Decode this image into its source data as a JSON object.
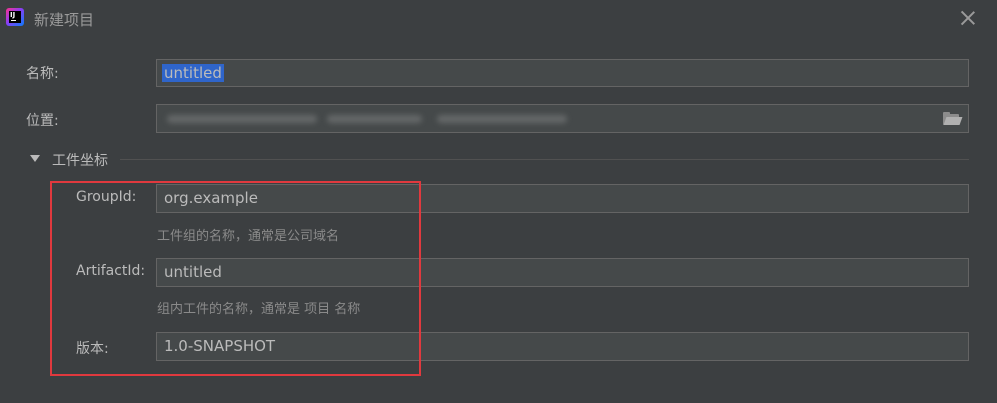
{
  "window": {
    "title": "新建项目",
    "app_icon_text": "IJ"
  },
  "form": {
    "name": {
      "label": "名称:",
      "value": "untitled"
    },
    "location": {
      "label": "位置:",
      "value": ""
    }
  },
  "artifact_section": {
    "title": "工件坐标",
    "expanded": true,
    "group_id": {
      "label": "GroupId:",
      "value": "org.example",
      "hint": "工件组的名称，通常是公司域名"
    },
    "artifact_id": {
      "label": "ArtifactId:",
      "value": "untitled",
      "hint": "组内工件的名称，通常是 项目 名称"
    },
    "version": {
      "label": "版本:",
      "value": "1.0-SNAPSHOT"
    }
  },
  "colors": {
    "background": "#3c3f41",
    "field_bg": "#45494a",
    "selection": "#2f65ca",
    "highlight_box": "#e0393e"
  }
}
